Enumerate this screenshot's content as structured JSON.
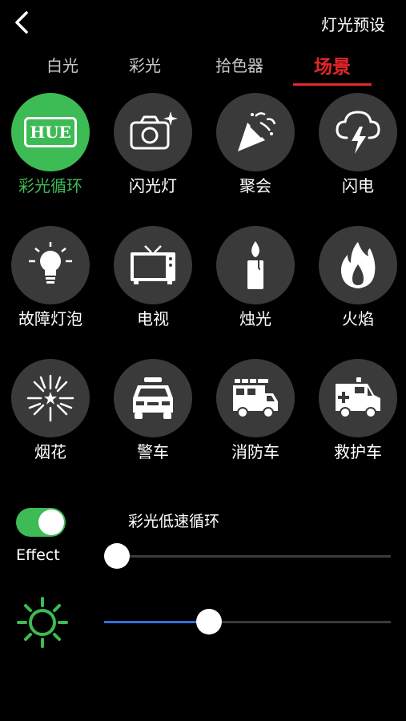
{
  "header": {
    "title": "灯光预设"
  },
  "tabs": [
    {
      "label": "白光"
    },
    {
      "label": "彩光"
    },
    {
      "label": "拾色器"
    },
    {
      "label": "场景"
    }
  ],
  "active_tab": "场景",
  "scenes": [
    {
      "label": "彩光循环",
      "icon": "hue-icon",
      "badge": "HUE",
      "selected": true
    },
    {
      "label": "闪光灯",
      "icon": "camera-icon"
    },
    {
      "label": "聚会",
      "icon": "party-popper-icon"
    },
    {
      "label": "闪电",
      "icon": "lightning-icon"
    },
    {
      "label": "故障灯泡",
      "icon": "lightbulb-icon"
    },
    {
      "label": "电视",
      "icon": "tv-icon"
    },
    {
      "label": "烛光",
      "icon": "candle-icon"
    },
    {
      "label": "火焰",
      "icon": "flame-icon"
    },
    {
      "label": "烟花",
      "icon": "firework-icon"
    },
    {
      "label": "警车",
      "icon": "police-car-icon"
    },
    {
      "label": "消防车",
      "icon": "fire-truck-icon"
    },
    {
      "label": "救护车",
      "icon": "ambulance-icon"
    }
  ],
  "effect": {
    "label": "Effect",
    "enabled": true,
    "mode_label": "彩光低速循环",
    "speed_value": 0.0
  },
  "brightness": {
    "value": 0.32
  },
  "colors": {
    "accent_green": "#3dbb54",
    "accent_red": "#e8262a",
    "slider_blue": "#2f6fe0",
    "circle_bg": "#3a3a3a"
  }
}
